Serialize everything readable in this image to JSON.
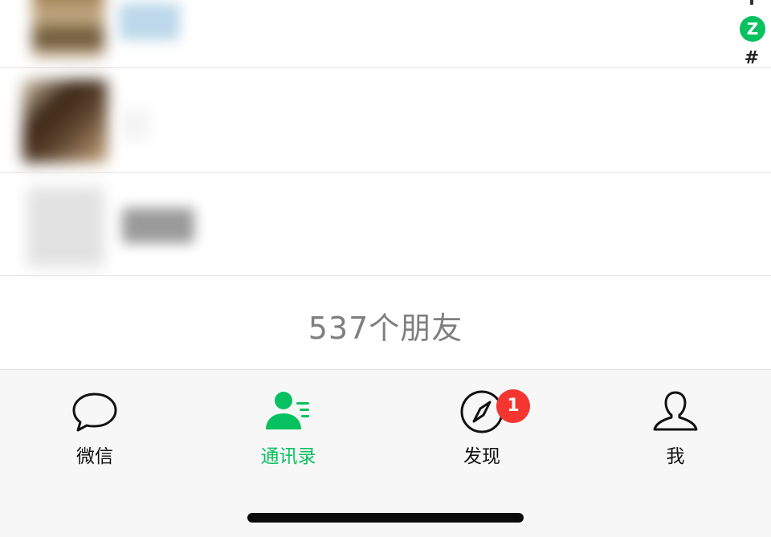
{
  "index_bar": {
    "current_letter": "Z",
    "hash_letter": "#"
  },
  "footer": {
    "friend_count": "537个朋友"
  },
  "tab_bar": {
    "tabs": [
      {
        "label": "微信",
        "icon": "chat-bubble-icon",
        "active": false
      },
      {
        "label": "通讯录",
        "icon": "contacts-icon",
        "active": true
      },
      {
        "label": "发现",
        "icon": "compass-icon",
        "active": false,
        "badge": "1"
      },
      {
        "label": "我",
        "icon": "person-icon",
        "active": false
      }
    ]
  },
  "colors": {
    "accent": "#07c160",
    "badge": "#f43530",
    "tab_bar_bg": "#f7f7f7",
    "count_text": "#7f7f7f"
  }
}
